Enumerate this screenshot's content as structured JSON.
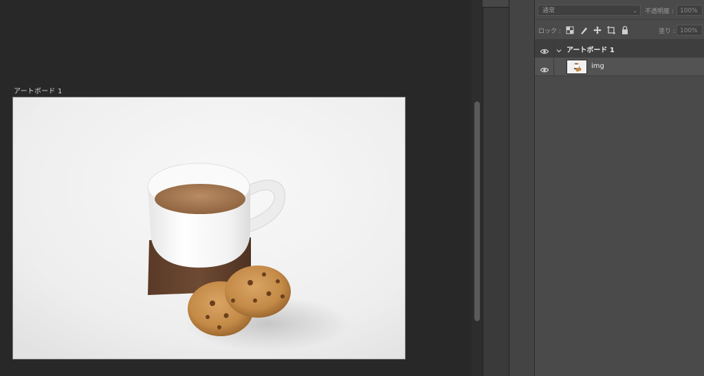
{
  "canvas": {
    "artboard_label": "アートボード 1"
  },
  "layers_panel": {
    "blend_mode": "通常",
    "opacity_label": "不透明度 :",
    "opacity_value": "100%",
    "lock_label": "ロック :",
    "fill_label": "塗り :",
    "fill_value": "100%",
    "lock_icons": [
      "lock-transparent-pixels-icon",
      "lock-image-pixels-icon",
      "lock-position-icon",
      "lock-artboard-icon",
      "lock-all-icon"
    ],
    "layers": [
      {
        "name": "アートボード 1",
        "type": "artboard-group",
        "visible": true,
        "expanded": true
      },
      {
        "name": "img",
        "type": "layer",
        "visible": true
      }
    ]
  },
  "colors": {
    "canvas_bg": "#282828",
    "panel_bg": "#4a4a4a",
    "selected_row": "#535353"
  }
}
